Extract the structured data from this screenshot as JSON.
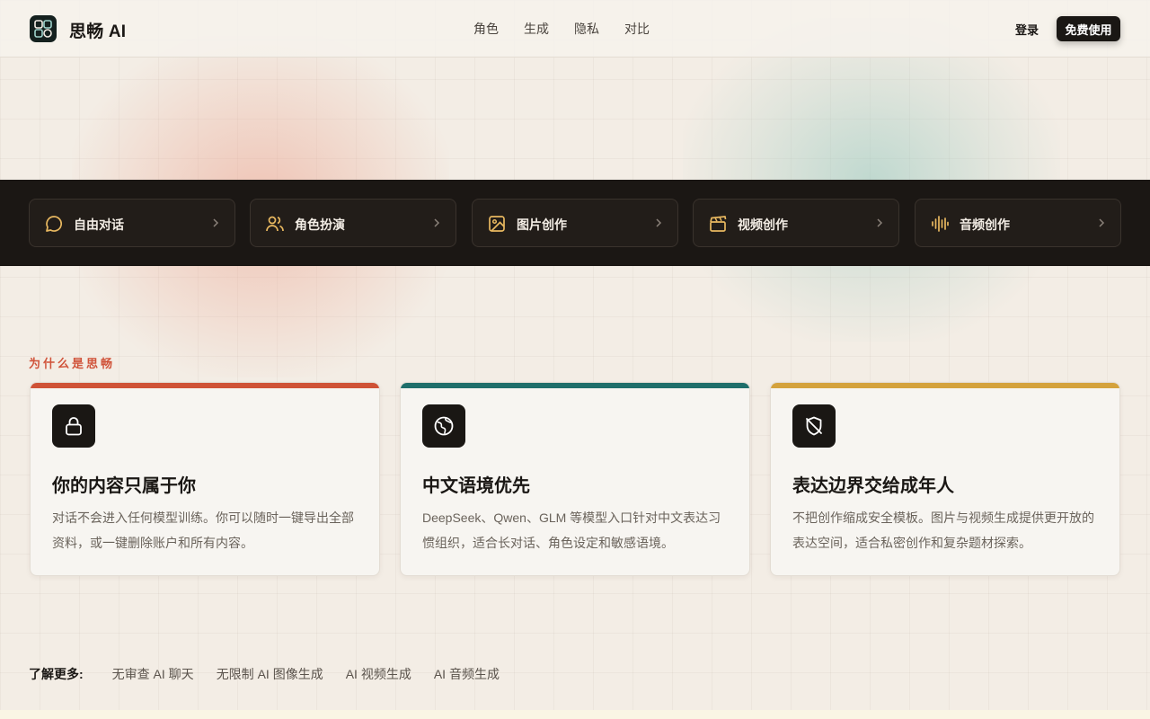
{
  "header": {
    "brand": "思畅 AI",
    "nav": [
      "角色",
      "生成",
      "隐私",
      "对比"
    ],
    "login": "登录",
    "cta": "免费使用"
  },
  "tools": [
    {
      "label": "自由对话",
      "icon": "chat-bubble-icon"
    },
    {
      "label": "角色扮演",
      "icon": "users-icon"
    },
    {
      "label": "图片创作",
      "icon": "image-icon"
    },
    {
      "label": "视频创作",
      "icon": "clapperboard-icon"
    },
    {
      "label": "音频创作",
      "icon": "audio-wave-icon"
    }
  ],
  "why": {
    "eyebrow": "为什么是思畅",
    "cards": [
      {
        "title": "你的内容只属于你",
        "desc": "对话不会进入任何模型训练。你可以随时一键导出全部资料，或一键删除账户和所有内容。",
        "icon": "lock-icon",
        "accent": "#cf5236"
      },
      {
        "title": "中文语境优先",
        "desc": "DeepSeek、Qwen、GLM 等模型入口针对中文表达习惯组织，适合长对话、角色设定和敏感语境。",
        "icon": "globe-icon",
        "accent": "#1e6e6a"
      },
      {
        "title": "表达边界交给成年人",
        "desc": "不把创作缩成安全模板。图片与视频生成提供更开放的表达空间，适合私密创作和复杂题材探索。",
        "icon": "shield-off-icon",
        "accent": "#d4a23c"
      }
    ]
  },
  "more": {
    "label": "了解更多:",
    "links": [
      "无审查 AI 聊天",
      "无限制 AI 图像生成",
      "AI 视频生成",
      "AI 音频生成"
    ]
  },
  "colors": {
    "accent_gold": "#e8b860",
    "dark": "#1b1714"
  }
}
